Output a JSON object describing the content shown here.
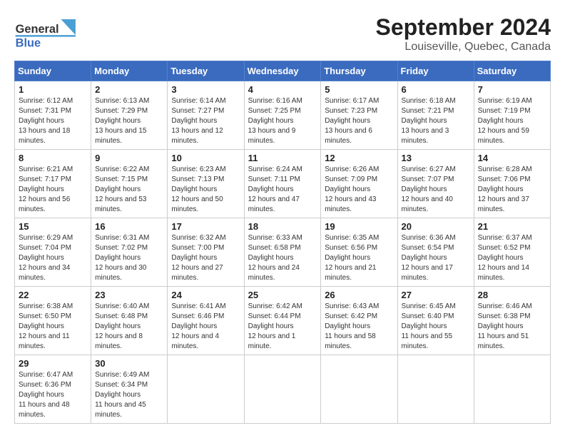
{
  "header": {
    "logo_text_general": "General",
    "logo_text_blue": "Blue",
    "title": "September 2024",
    "subtitle": "Louiseville, Quebec, Canada"
  },
  "calendar": {
    "days_of_week": [
      "Sunday",
      "Monday",
      "Tuesday",
      "Wednesday",
      "Thursday",
      "Friday",
      "Saturday"
    ],
    "weeks": [
      [
        null,
        {
          "day": "2",
          "sunrise": "Sunrise: 6:13 AM",
          "sunset": "Sunset: 7:29 PM",
          "daylight": "Daylight: 13 hours and 15 minutes."
        },
        {
          "day": "3",
          "sunrise": "Sunrise: 6:14 AM",
          "sunset": "Sunset: 7:27 PM",
          "daylight": "Daylight: 13 hours and 12 minutes."
        },
        {
          "day": "4",
          "sunrise": "Sunrise: 6:16 AM",
          "sunset": "Sunset: 7:25 PM",
          "daylight": "Daylight: 13 hours and 9 minutes."
        },
        {
          "day": "5",
          "sunrise": "Sunrise: 6:17 AM",
          "sunset": "Sunset: 7:23 PM",
          "daylight": "Daylight: 13 hours and 6 minutes."
        },
        {
          "day": "6",
          "sunrise": "Sunrise: 6:18 AM",
          "sunset": "Sunset: 7:21 PM",
          "daylight": "Daylight: 13 hours and 3 minutes."
        },
        {
          "day": "7",
          "sunrise": "Sunrise: 6:19 AM",
          "sunset": "Sunset: 7:19 PM",
          "daylight": "Daylight: 12 hours and 59 minutes."
        }
      ],
      [
        {
          "day": "1",
          "sunrise": "Sunrise: 6:12 AM",
          "sunset": "Sunset: 7:31 PM",
          "daylight": "Daylight: 13 hours and 18 minutes."
        },
        {
          "day": "9",
          "sunrise": "Sunrise: 6:22 AM",
          "sunset": "Sunset: 7:15 PM",
          "daylight": "Daylight: 12 hours and 53 minutes."
        },
        {
          "day": "10",
          "sunrise": "Sunrise: 6:23 AM",
          "sunset": "Sunset: 7:13 PM",
          "daylight": "Daylight: 12 hours and 50 minutes."
        },
        {
          "day": "11",
          "sunrise": "Sunrise: 6:24 AM",
          "sunset": "Sunset: 7:11 PM",
          "daylight": "Daylight: 12 hours and 47 minutes."
        },
        {
          "day": "12",
          "sunrise": "Sunrise: 6:26 AM",
          "sunset": "Sunset: 7:09 PM",
          "daylight": "Daylight: 12 hours and 43 minutes."
        },
        {
          "day": "13",
          "sunrise": "Sunrise: 6:27 AM",
          "sunset": "Sunset: 7:07 PM",
          "daylight": "Daylight: 12 hours and 40 minutes."
        },
        {
          "day": "14",
          "sunrise": "Sunrise: 6:28 AM",
          "sunset": "Sunset: 7:06 PM",
          "daylight": "Daylight: 12 hours and 37 minutes."
        }
      ],
      [
        {
          "day": "8",
          "sunrise": "Sunrise: 6:21 AM",
          "sunset": "Sunset: 7:17 PM",
          "daylight": "Daylight: 12 hours and 56 minutes."
        },
        {
          "day": "16",
          "sunrise": "Sunrise: 6:31 AM",
          "sunset": "Sunset: 7:02 PM",
          "daylight": "Daylight: 12 hours and 30 minutes."
        },
        {
          "day": "17",
          "sunrise": "Sunrise: 6:32 AM",
          "sunset": "Sunset: 7:00 PM",
          "daylight": "Daylight: 12 hours and 27 minutes."
        },
        {
          "day": "18",
          "sunrise": "Sunrise: 6:33 AM",
          "sunset": "Sunset: 6:58 PM",
          "daylight": "Daylight: 12 hours and 24 minutes."
        },
        {
          "day": "19",
          "sunrise": "Sunrise: 6:35 AM",
          "sunset": "Sunset: 6:56 PM",
          "daylight": "Daylight: 12 hours and 21 minutes."
        },
        {
          "day": "20",
          "sunrise": "Sunrise: 6:36 AM",
          "sunset": "Sunset: 6:54 PM",
          "daylight": "Daylight: 12 hours and 17 minutes."
        },
        {
          "day": "21",
          "sunrise": "Sunrise: 6:37 AM",
          "sunset": "Sunset: 6:52 PM",
          "daylight": "Daylight: 12 hours and 14 minutes."
        }
      ],
      [
        {
          "day": "15",
          "sunrise": "Sunrise: 6:29 AM",
          "sunset": "Sunset: 7:04 PM",
          "daylight": "Daylight: 12 hours and 34 minutes."
        },
        {
          "day": "23",
          "sunrise": "Sunrise: 6:40 AM",
          "sunset": "Sunset: 6:48 PM",
          "daylight": "Daylight: 12 hours and 8 minutes."
        },
        {
          "day": "24",
          "sunrise": "Sunrise: 6:41 AM",
          "sunset": "Sunset: 6:46 PM",
          "daylight": "Daylight: 12 hours and 4 minutes."
        },
        {
          "day": "25",
          "sunrise": "Sunrise: 6:42 AM",
          "sunset": "Sunset: 6:44 PM",
          "daylight": "Daylight: 12 hours and 1 minute."
        },
        {
          "day": "26",
          "sunrise": "Sunrise: 6:43 AM",
          "sunset": "Sunset: 6:42 PM",
          "daylight": "Daylight: 11 hours and 58 minutes."
        },
        {
          "day": "27",
          "sunrise": "Sunrise: 6:45 AM",
          "sunset": "Sunset: 6:40 PM",
          "daylight": "Daylight: 11 hours and 55 minutes."
        },
        {
          "day": "28",
          "sunrise": "Sunrise: 6:46 AM",
          "sunset": "Sunset: 6:38 PM",
          "daylight": "Daylight: 11 hours and 51 minutes."
        }
      ],
      [
        {
          "day": "22",
          "sunrise": "Sunrise: 6:38 AM",
          "sunset": "Sunset: 6:50 PM",
          "daylight": "Daylight: 12 hours and 11 minutes."
        },
        {
          "day": "30",
          "sunrise": "Sunrise: 6:49 AM",
          "sunset": "Sunset: 6:34 PM",
          "daylight": "Daylight: 11 hours and 45 minutes."
        },
        null,
        null,
        null,
        null,
        null
      ],
      [
        {
          "day": "29",
          "sunrise": "Sunrise: 6:47 AM",
          "sunset": "Sunset: 6:36 PM",
          "daylight": "Daylight: 11 hours and 48 minutes."
        },
        null,
        null,
        null,
        null,
        null,
        null
      ]
    ]
  }
}
